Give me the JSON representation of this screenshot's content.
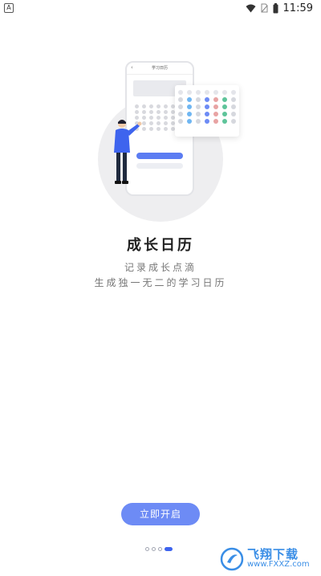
{
  "status_bar": {
    "left_badge": "A",
    "time": "11:59",
    "icons": [
      "wifi-icon",
      "sim-icon",
      "battery-icon"
    ]
  },
  "illustration": {
    "phone_title": "学习日历"
  },
  "onboarding": {
    "title": "成长日历",
    "subtitle_line1": "记录成长点滴",
    "subtitle_line2": "生成独一无二的学习日历"
  },
  "actions": {
    "start_label": "立即开启"
  },
  "pager": {
    "total_pages": 4,
    "active_page": 4
  },
  "watermark": {
    "text": "飞翔下载",
    "url": "www.FXXZ.com"
  },
  "colors": {
    "accent": "#6d8bf5",
    "indicator_active": "#3e64ee"
  }
}
